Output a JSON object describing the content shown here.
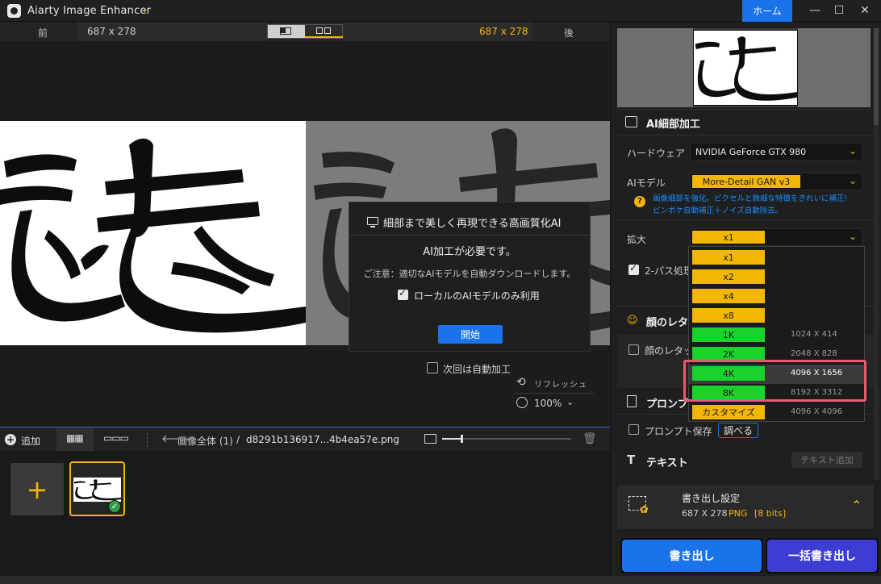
{
  "app": {
    "title": "Aiarty Image Enhancer",
    "home_label": "ホーム",
    "accent_color": "#f2b705",
    "primary_color": "#1a73e8"
  },
  "compare": {
    "before_label": "前",
    "before_size": "687 x 278",
    "after_size": "687 x 278",
    "after_label": "後"
  },
  "dialog": {
    "title": "細部まで美しく再現できる高画質化AI",
    "need_text": "AI加工が必要です。",
    "note": "ご注意：適切なAIモデルを自動ダウンロードします。",
    "local_only_label": "ローカルのAIモデルのみ利用",
    "start_label": "開始"
  },
  "canvas": {
    "auto_process_label": "次回は自動加工",
    "refresh_label": "リフレッシュ",
    "zoom": "100%"
  },
  "bottom_bar": {
    "add_label": "追加",
    "breadcrumb_all": "画像全体 (1)",
    "breadcrumb_sep": "/",
    "file_name": "d8291b136917...4b4ea57e.png",
    "thumb_size_fraction": 0.15
  },
  "panel": {
    "ai_section_title": "AI細部加工",
    "hardware_label": "ハードウェア",
    "hardware_value": "NVIDIA GeForce GTX 980",
    "model_label": "AIモデル",
    "model_value": "More-Detail GAN  v3",
    "model_desc_1": "画像細部を強化。ピクセルと微細な特徴をきれいに補正!",
    "model_desc_2": "ピンボケ自動補正＋ノイズ自動除去。",
    "scale_label": "拡大",
    "scale_value": "x1",
    "two_pass_label": "2-パス処理",
    "face_title": "顔のレタッ",
    "face_option": "顔のレタッ",
    "prompt_title": "プロンプ",
    "prompt_save_label": "プロンプト保存",
    "prompt_check_label": "調べる",
    "text_title": "テキスト",
    "text_add_label": "テキスト追加",
    "export_title": "書き出し設定",
    "export_size": "687 X 278",
    "export_format": "PNG",
    "export_bits": "[8 bits]",
    "export_button": "書き出し",
    "batch_export_button": "一括書き出し"
  },
  "scale_options": [
    {
      "label": "x1",
      "res": "",
      "color": "y"
    },
    {
      "label": "x2",
      "res": "",
      "color": "y"
    },
    {
      "label": "x4",
      "res": "",
      "color": "y"
    },
    {
      "label": "x8",
      "res": "",
      "color": "y"
    },
    {
      "label": "1K",
      "res": "1024 X 414",
      "color": "g"
    },
    {
      "label": "2K",
      "res": "2048 X 828",
      "color": "g"
    },
    {
      "label": "4K",
      "res": "4096 X 1656",
      "color": "g"
    },
    {
      "label": "8K",
      "res": "8192 X 3312",
      "color": "g"
    },
    {
      "label": "カスタマイズ",
      "res": "4096 X 4096",
      "color": "y"
    }
  ],
  "icons": {
    "app_chevron": "⌄",
    "minimize": "—",
    "maximize": "☐",
    "close": "✕",
    "chevron": "⌄",
    "back_arrow": "🡐",
    "trash": "🗑",
    "refresh": "⟲",
    "face": "☺",
    "text": "T",
    "gear": "✿",
    "collapse": "⌃",
    "help": "?",
    "check": "✓",
    "plus": "+",
    "grid_view": "▦▦",
    "strip_view": "▭▭▭"
  }
}
